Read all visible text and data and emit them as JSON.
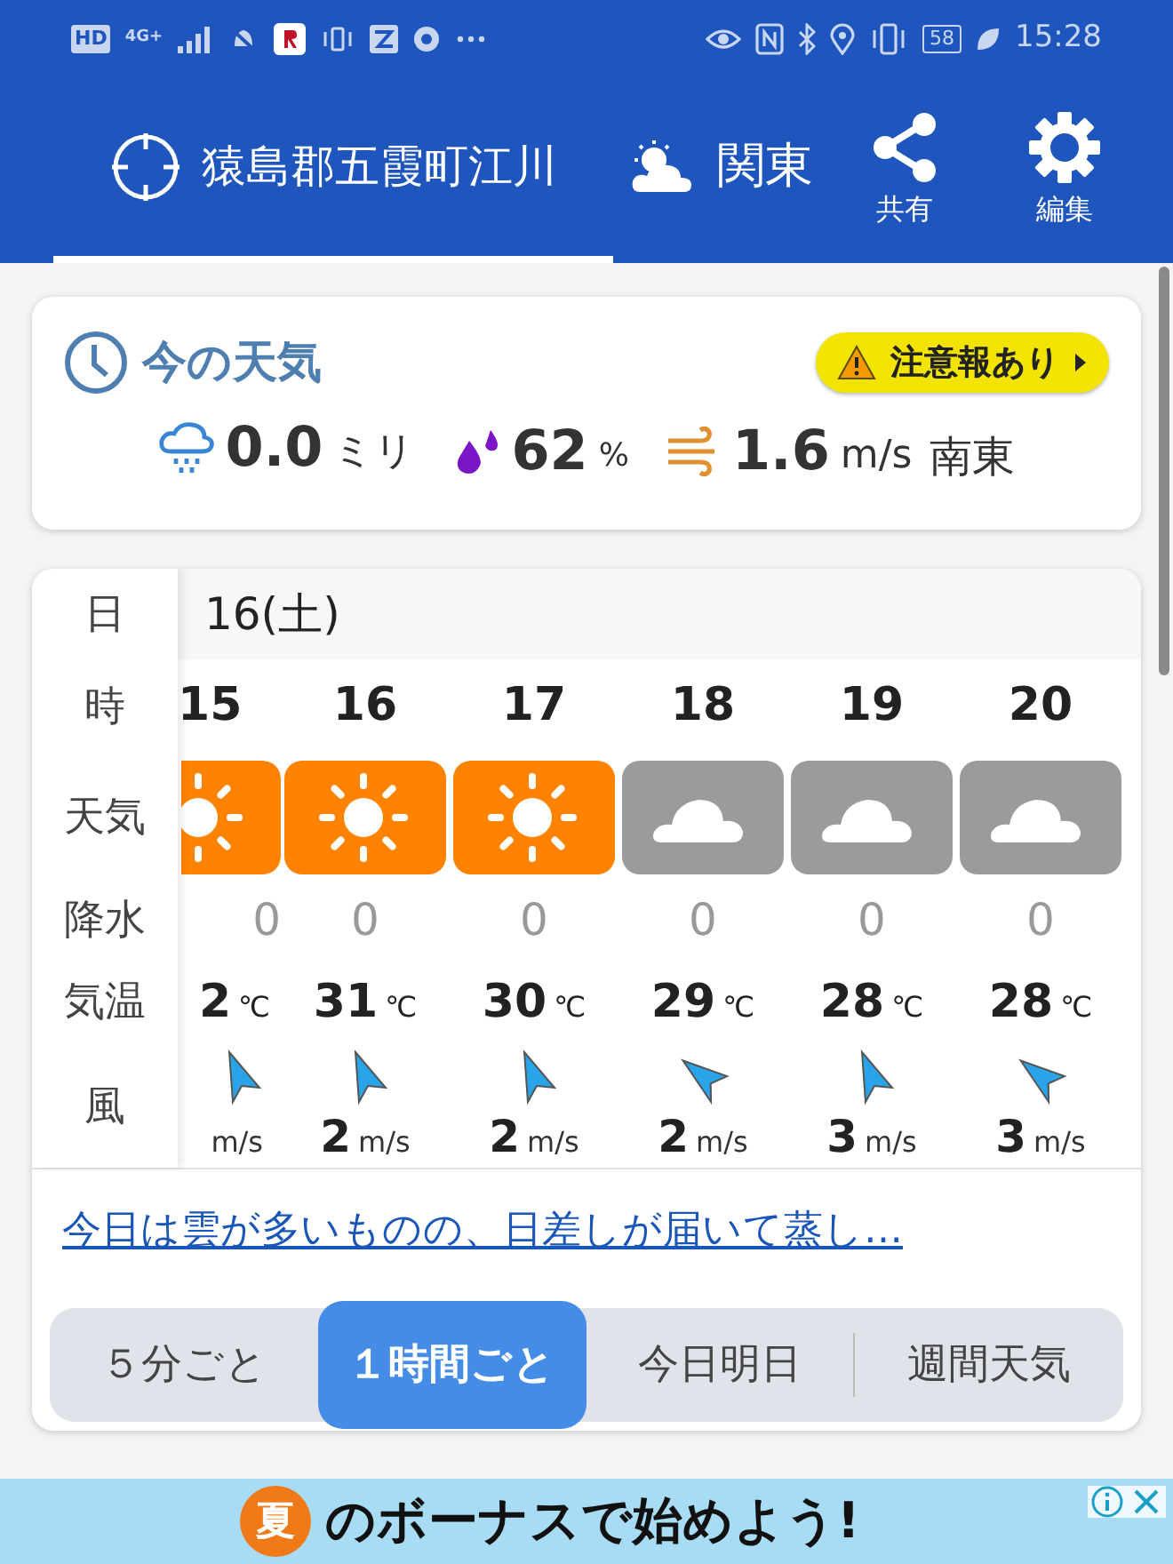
{
  "status_bar": {
    "left_labels": [
      "HD",
      "4G+"
    ],
    "battery": "58",
    "time": "15:28"
  },
  "header": {
    "location": "猿島郡五霞町江川",
    "region": "関東",
    "share": "共有",
    "edit": "編集",
    "tabs": [
      {
        "selected": true
      },
      {
        "selected": false
      }
    ]
  },
  "current": {
    "title": "今の天気",
    "alert": "注意報あり",
    "rain_value": "0.0",
    "rain_unit": "ミリ",
    "humidity_value": "62",
    "humidity_unit": "%",
    "wind_value": "1.6",
    "wind_unit": "m/s",
    "wind_dir": "南東"
  },
  "hourly": {
    "row_labels": [
      "日",
      "時",
      "天気",
      "降水",
      "気温",
      "風"
    ],
    "date": "16(土)",
    "columns": [
      {
        "hour": "15",
        "kind": "sunny",
        "rain": "0",
        "temp": "2",
        "temp_unit": "℃",
        "arrow_tilted": false,
        "speed_unit": "m/s",
        "partial": true
      },
      {
        "hour": "16",
        "kind": "sunny",
        "rain": "0",
        "temp": "31",
        "temp_unit": "℃",
        "arrow_tilted": false,
        "speed": "2",
        "speed_unit": "m/s",
        "partial": false
      },
      {
        "hour": "17",
        "kind": "sunny",
        "rain": "0",
        "temp": "30",
        "temp_unit": "℃",
        "arrow_tilted": false,
        "speed": "2",
        "speed_unit": "m/s",
        "partial": false
      },
      {
        "hour": "18",
        "kind": "cloudy",
        "rain": "0",
        "temp": "29",
        "temp_unit": "℃",
        "arrow_tilted": true,
        "speed": "2",
        "speed_unit": "m/s",
        "partial": false
      },
      {
        "hour": "19",
        "kind": "cloudy",
        "rain": "0",
        "temp": "28",
        "temp_unit": "℃",
        "arrow_tilted": false,
        "speed": "3",
        "speed_unit": "m/s",
        "partial": false
      },
      {
        "hour": "20",
        "kind": "cloudy",
        "rain": "0",
        "temp": "28",
        "temp_unit": "℃",
        "arrow_tilted": true,
        "speed": "3",
        "speed_unit": "m/s",
        "partial": false
      }
    ]
  },
  "summary_link": "今日は雲が多いものの、日差しが届いて蒸し…",
  "modes": [
    {
      "label": "５分ごと",
      "selected": false
    },
    {
      "label": "１時間ごと",
      "selected": true
    },
    {
      "label": "今日明日",
      "selected": false
    },
    {
      "label": "週間天気",
      "selected": false
    }
  ],
  "ad": {
    "badge": "夏",
    "text": "のボーナスで始めよう!"
  }
}
